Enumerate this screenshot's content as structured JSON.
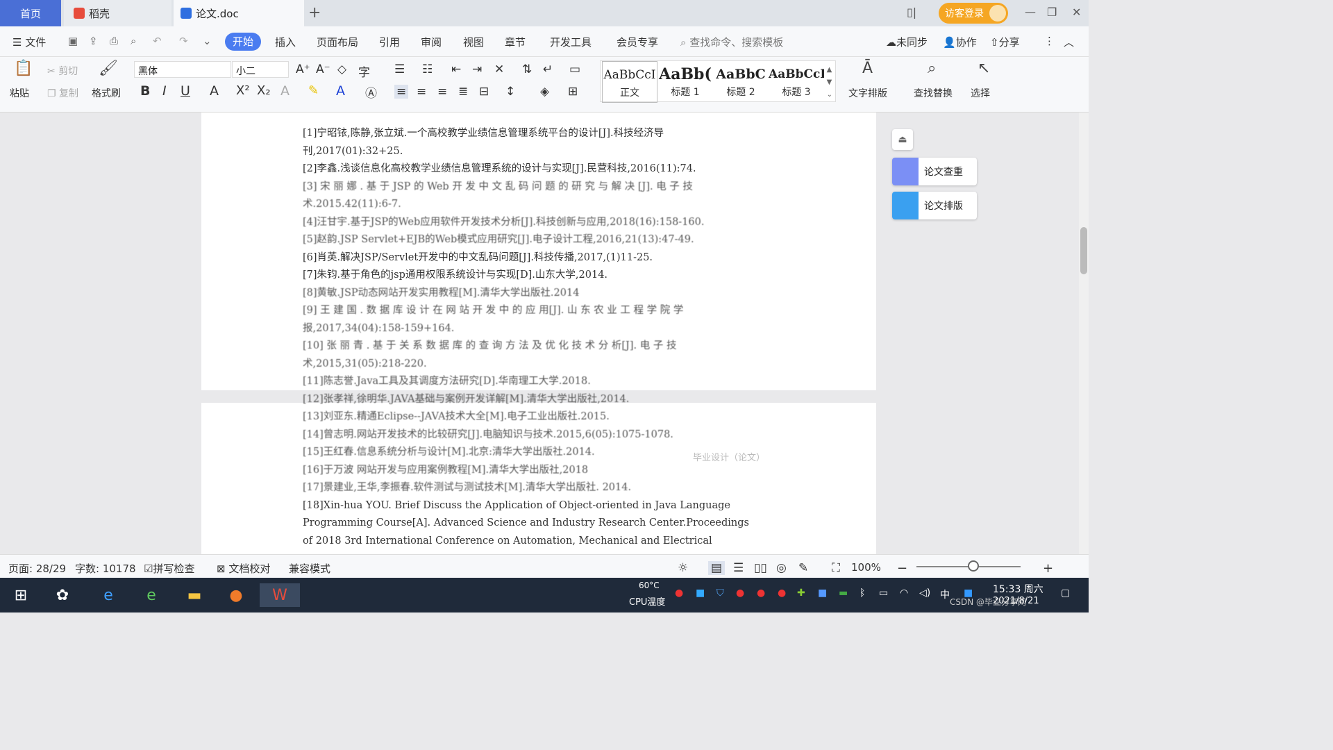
{
  "tabs": {
    "home": "首页",
    "daoke": "稻壳",
    "doc": "论文.doc"
  },
  "titlebar": {
    "login": "访客登录"
  },
  "menu": {
    "file": "文件",
    "items": [
      "开始",
      "插入",
      "页面布局",
      "引用",
      "审阅",
      "视图",
      "章节",
      "开发工具",
      "会员专享"
    ],
    "search_placeholder": "查找命令、搜索模板",
    "sync": "未同步",
    "collab": "协作",
    "share": "分享"
  },
  "ribbon": {
    "paste": "粘贴",
    "cut": "剪切",
    "copy": "复制",
    "format_painter": "格式刷",
    "font_name": "黑体",
    "font_size": "小二",
    "styles": [
      {
        "preview": "AaBbCcI",
        "label": "正文"
      },
      {
        "preview": "AaBb(",
        "label": "标题 1"
      },
      {
        "preview": "AaBbC",
        "label": "标题 2"
      },
      {
        "preview": "AaBbCcI",
        "label": "标题 3"
      }
    ],
    "text_layout": "文字排版",
    "find_replace": "查找替换",
    "select": "选择"
  },
  "references": [
    "[1]宁昭铱,陈静,张立斌.一个高校教学业绩信息管理系统平台的设计[J].科技经济导",
    "刊,2017(01):32+25.",
    "[2]李鑫.浅谈信息化高校教学业绩信息管理系统的设计与实现[J].民营科技,2016(11):74.",
    "[3] 宋 丽 娜 . 基 于 JSP 的 Web 开 发 中 文 乱 码 问 题 的 研 究 与 解 决 [J]. 电 子 技",
    "术.2015.42(11):6-7.",
    "[4]汪甘宇.基于JSP的Web应用软件开发技术分析[J].科技创新与应用,2018(16):158-160.",
    "[5]赵韵.JSP Servlet+EJB的Web模式应用研究[J].电子设计工程,2016,21(13):47-49.",
    "[6]肖英.解决JSP/Servlet开发中的中文乱码问题[J].科技传播,2017,(1)11-25.",
    "[7]朱钧.基于角色的jsp通用权限系统设计与实现[D].山东大学,2014.",
    "[8]黄敏.JSP动态网站开发实用教程[M].清华大学出版社.2014",
    "[9] 王 建 国 . 数 据 库 设 计 在 网 站 开 发 中 的 应 用[J]. 山 东 农 业 工 程 学 院 学",
    "报,2017,34(04):158-159+164.",
    "[10] 张 丽 青 . 基 于 关 系 数 据 库 的 查 询 方 法 及 优 化 技 术 分 析[J]. 电 子 技",
    "术,2015,31(05):218-220.",
    "[11]陈志誉.Java工具及其调度方法研究[D].华南理工大学.2018.",
    "[12]张孝祥,徐明华.JAVA基础与案例开发详解[M].清华大学出版社,2014.",
    "[13]刘亚东.精通Eclipse--JAVA技术大全[M].电子工业出版社.2015.",
    "[14]曾志明.网站开发技术的比较研究[J].电脑知识与技术.2015,6(05):1075-1078.",
    "[15]王红春.信息系统分析与设计[M].北京:清华大学出版社.2014.",
    "[16]于万波 网站开发与应用案例教程[M].清华大学出版社,2018",
    "[17]景建业,王华,李振春.软件测试与测试技术[M].清华大学出版社. 2014.",
    "[18]Xin-hua YOU. Brief Discuss the Application of Object-oriented in Java Language",
    "Programming Course[A]. Advanced Science and Industry Research Center.Proceedings",
    "of 2018 3rd International Conference on Automation, Mechanical and Electrical"
  ],
  "page_footer": "毕业设计（论文）",
  "side_panel": {
    "check": "论文查重",
    "layout": "论文排版"
  },
  "status": {
    "page": "页面: 28/29",
    "words": "字数: 10178",
    "spell": "拼写检查",
    "proof": "文档校对",
    "compat": "兼容模式",
    "zoom": "100%"
  },
  "taskbar": {
    "cpu_temp": "60°C",
    "cpu_label": "CPU温度",
    "ime": "中",
    "time": "15:33 周六",
    "date": "2021/8/21",
    "watermark": "CSDN @毕业分享网"
  }
}
